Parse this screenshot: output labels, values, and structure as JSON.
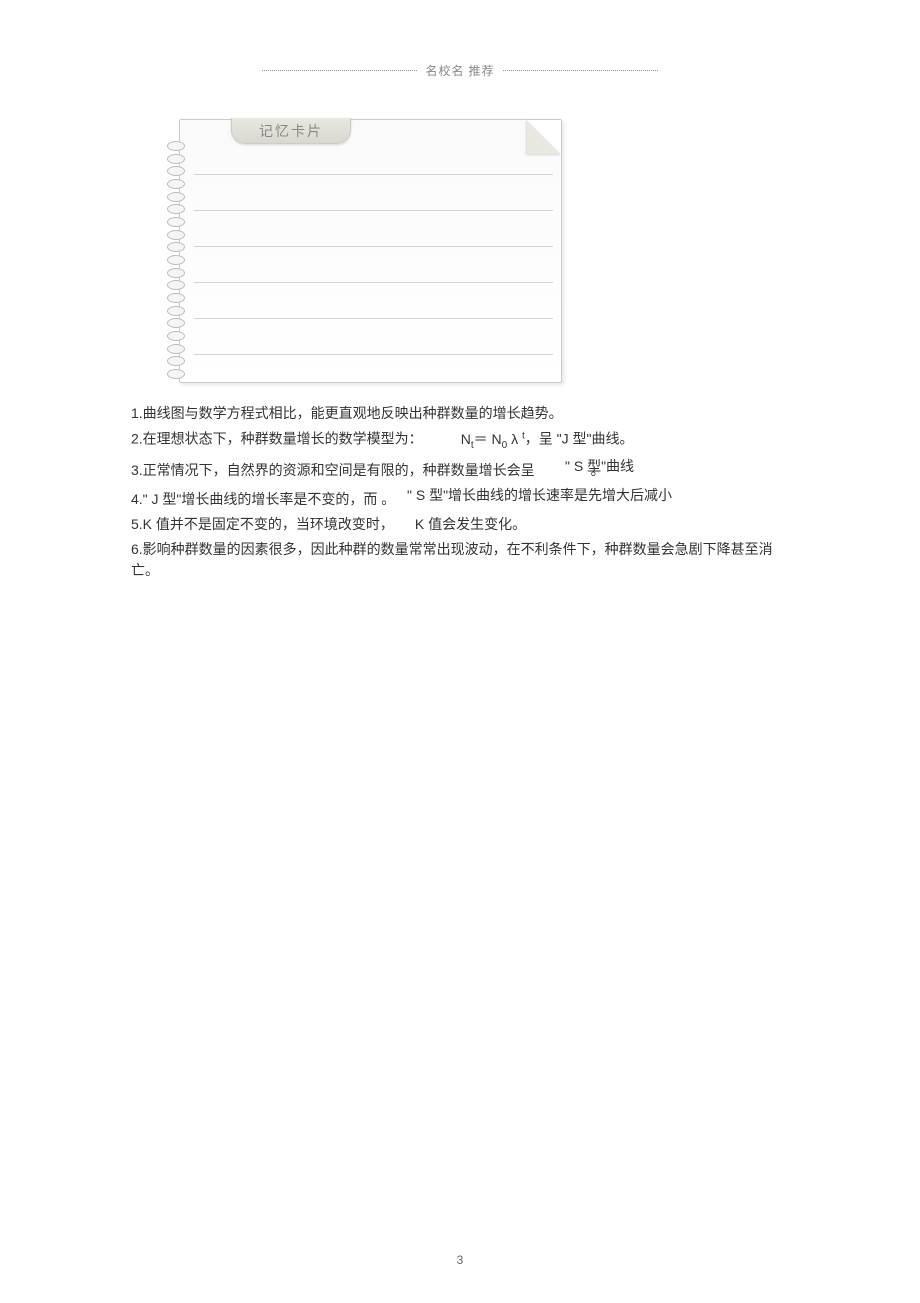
{
  "header": {
    "text": "名校名  推荐"
  },
  "notebook": {
    "tab_label": "记忆卡片"
  },
  "content": {
    "line1": "1.曲线图与数学方程式相比，能更直观地反映出种群数量的增长趋势。",
    "line2_a": "2.在理想状态下，种群数量增长的数学模型为：",
    "line2_b_prefix": "N",
    "line2_b_sub1": "t",
    "line2_b_eq": "＝",
    "line2_b_n0": "N",
    "line2_b_sub0": "0",
    "line2_b_lambda": "λ",
    "line2_b_supt": "t",
    "line2_b_suffix": "，呈 \"J 型\"曲线。",
    "line2_note": "\" S 型\"曲线",
    "line3": "3.正常情况下，自然界的资源和空间是有限的，种群数量增长会呈　　　　。",
    "line3_note": "\" S 型\"增长曲线的增长速率是先增大后减小",
    "line4": "4.\" J 型\"增长曲线的增长率是不变的，而 。",
    "line5": "5.K 值并不是固定不变的，当环境改变时，　　K 值会发生变化。",
    "line6": "6.影响种群数量的因素很多，因此种群的数量常常出现波动，在不利条件下，种群数量会急剧下降甚至消亡。"
  },
  "page_number": "3"
}
